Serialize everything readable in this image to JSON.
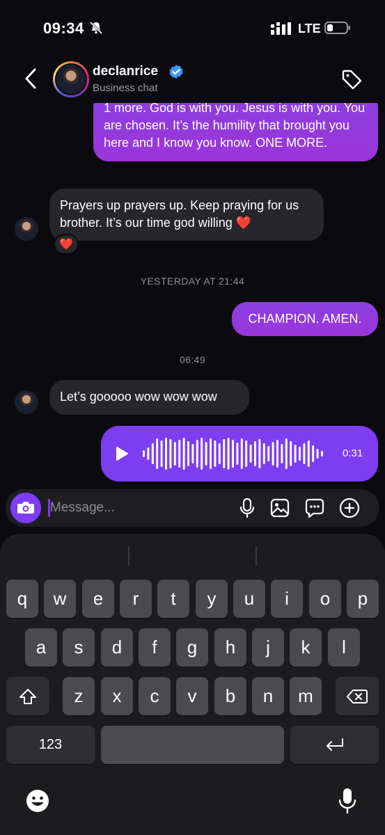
{
  "status_bar": {
    "time": "09:34",
    "network": "LTE",
    "icons": [
      "silent-bell-icon",
      "signal-icon",
      "battery-icon"
    ]
  },
  "header": {
    "name": "declanrice",
    "subtitle": "Business chat",
    "icons": [
      "back-icon",
      "verified-badge-icon",
      "tag-icon"
    ]
  },
  "messages": [
    {
      "from": "me",
      "text": "1 more. God is with you. Jesus is with you. You are chosen. It’s the humility that brought you here and I know you know. ONE MORE."
    },
    {
      "from": "them",
      "text": "Prayers up prayers up. Keep praying for us brother. It’s our time god willing ❤️",
      "reaction": "❤️"
    },
    {
      "type": "timestamp",
      "text": "YESTERDAY AT 21:44"
    },
    {
      "from": "me",
      "text": "CHAMPION. AMEN."
    },
    {
      "type": "timestamp",
      "text": "06:49"
    },
    {
      "from": "them",
      "text": "Let’s gooooo wow wow wow"
    },
    {
      "from": "me",
      "type": "voice",
      "duration": "0:31"
    }
  ],
  "composer": {
    "placeholder": "Message...",
    "icons": [
      "camera-icon",
      "microphone-icon",
      "gallery-icon",
      "sticker-icon",
      "add-icon"
    ]
  },
  "keyboard": {
    "row1": [
      "q",
      "w",
      "e",
      "r",
      "t",
      "y",
      "u",
      "i",
      "o",
      "p"
    ],
    "row2": [
      "a",
      "s",
      "d",
      "f",
      "g",
      "h",
      "j",
      "k",
      "l"
    ],
    "row3": [
      "z",
      "x",
      "c",
      "v",
      "b",
      "n",
      "m"
    ],
    "numbers_label": "123",
    "icons": [
      "shift-icon",
      "backspace-icon",
      "return-icon",
      "emoji-icon",
      "dictation-icon"
    ]
  },
  "colors": {
    "accent": "#7d3df0",
    "bubble_out": "#8b3fe0",
    "bubble_in": "#26262b",
    "background": "#0b0b0f"
  }
}
